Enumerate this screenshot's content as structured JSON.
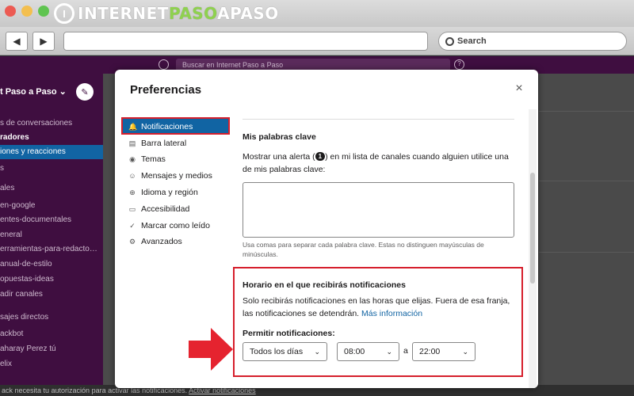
{
  "browser": {
    "logo": {
      "prefix": "INTERNET",
      "accent": "PASO",
      "suffix": "APASO",
      "mark": "I",
      "accent_color": "#8fd14f"
    },
    "nav": {
      "back": "◀",
      "forward": "▶"
    },
    "search": {
      "label": "Search"
    }
  },
  "slack": {
    "search_placeholder": "Buscar en Internet Paso a Paso",
    "help_glyph": "?",
    "workspace": "t Paso a Paso ⌄",
    "compose_glyph": "✎",
    "sidebar": [
      {
        "label": "s de conversaciones"
      },
      {
        "label": "radores"
      },
      {
        "label": "iones y reacciones"
      },
      {
        "label": "s"
      },
      {
        "label": "ales"
      },
      {
        "label": "en-google"
      },
      {
        "label": "entes-documentales"
      },
      {
        "label": "eneral"
      },
      {
        "label": "erramientas-para-redacto…"
      },
      {
        "label": "anual-de-estilo"
      },
      {
        "label": "opuestas-ideas"
      },
      {
        "label": "adir canales"
      },
      {
        "label": "sajes directos"
      },
      {
        "label": "ackbot"
      },
      {
        "label": "aharay Perez  tú"
      },
      {
        "label": "elix"
      }
    ],
    "notice": {
      "text": "ack necesita tu autorización para activar las notificaciones.",
      "link": "Activar notificaciones"
    }
  },
  "modal": {
    "title": "Preferencias",
    "close": "×",
    "nav": [
      {
        "label": "Notificaciones",
        "icon": "bell-icon",
        "glyph": "🔔",
        "active": true
      },
      {
        "label": "Barra lateral",
        "icon": "sidebar-icon",
        "glyph": "▤",
        "active": false
      },
      {
        "label": "Temas",
        "icon": "eye-icon",
        "glyph": "◉",
        "active": false
      },
      {
        "label": "Mensajes y medios",
        "icon": "message-icon",
        "glyph": "☺",
        "active": false
      },
      {
        "label": "Idioma y región",
        "icon": "globe-icon",
        "glyph": "⊕",
        "active": false
      },
      {
        "label": "Accesibilidad",
        "icon": "laptop-icon",
        "glyph": "▭",
        "active": false
      },
      {
        "label": "Marcar como leído",
        "icon": "check-icon",
        "glyph": "✓",
        "active": false
      },
      {
        "label": "Avanzados",
        "icon": "gear-icon",
        "glyph": "⚙",
        "active": false
      }
    ],
    "keywords": {
      "title": "Mis palabras clave",
      "desc_before": "Mostrar una alerta (",
      "badge": "1",
      "desc_after": ") en mi lista de canales cuando alguien utilice una de mis palabras clave:",
      "hint": "Usa comas para separar cada palabra clave. Estas no distinguen mayúsculas de minúsculas."
    },
    "schedule": {
      "title": "Horario en el que recibirás notificaciones",
      "desc": "Solo recibirás notificaciones en las horas que elijas. Fuera de esa franja, las notificaciones se detendrán.",
      "more_link": "Más información",
      "allow_label": "Permitir notificaciones:",
      "days": "Todos los días",
      "from": "08:00",
      "separator": "a",
      "to": "22:00"
    }
  },
  "colors": {
    "highlight": "#d61f2c",
    "active_nav": "#1164a3",
    "slack_purple": "#3f0e40"
  }
}
